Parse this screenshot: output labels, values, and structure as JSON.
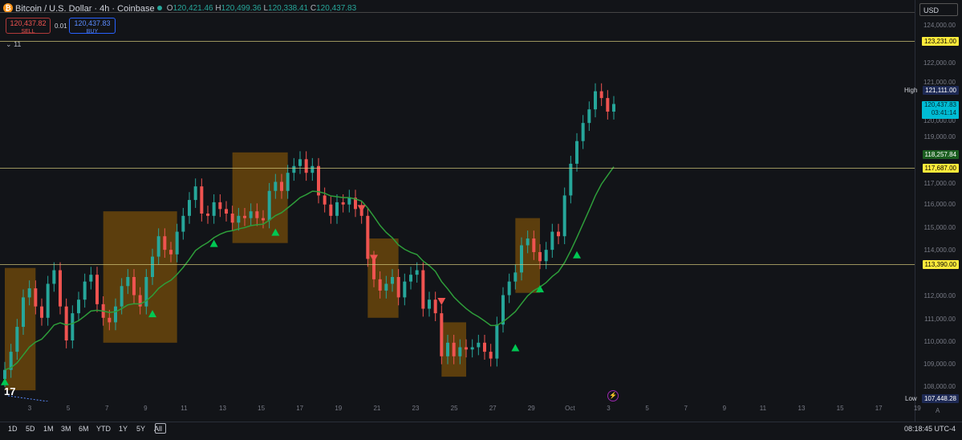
{
  "header": {
    "symbol_title": "Bitcoin / U.S. Dollar · 4h · Coinbase",
    "ohlc": [
      {
        "key": "O",
        "value": "120,421.46"
      },
      {
        "key": "H",
        "value": "120,499.36"
      },
      {
        "key": "L",
        "value": "120,338.41"
      },
      {
        "key": "C",
        "value": "120,437.83"
      }
    ]
  },
  "trade": {
    "sell_price": "120,437.82",
    "sell_label": "SELL",
    "spread": "0.01",
    "buy_price": "120,437.83",
    "buy_label": "BUY"
  },
  "indicators_toggle": "11",
  "currency": "USD",
  "price_axis": {
    "ticks": [
      "124,000.00",
      "122,000.00",
      "121,000.00",
      "120,000.00",
      "119,000.00",
      "117,000.00",
      "116,000.00",
      "115,000.00",
      "114,000.00",
      "112,000.00",
      "111,000.00",
      "110,000.00",
      "109,000.00",
      "108,000.00"
    ],
    "tags": {
      "level_1": "123,231.00",
      "high_label": "High",
      "high": "121,111.00",
      "last_price": "120,437.83",
      "countdown": "03:41:14",
      "ema": "118,257.84",
      "level_2": "117,687.00",
      "level_3": "113,390.00",
      "low_label": "Low",
      "low": "107,448.28"
    }
  },
  "time_axis": [
    "3",
    "5",
    "7",
    "9",
    "11",
    "13",
    "15",
    "17",
    "19",
    "21",
    "23",
    "25",
    "27",
    "29",
    "Oct",
    "3",
    "5",
    "7",
    "9",
    "11",
    "13",
    "15",
    "17",
    "19"
  ],
  "timeframes": [
    "1D",
    "5D",
    "1M",
    "3M",
    "6M",
    "YTD",
    "1Y",
    "5Y",
    "All"
  ],
  "clock": "08:18:45 UTC-4",
  "colors": {
    "up": "#26a69a",
    "down": "#ef5350",
    "accent_up": "#00c853",
    "band": "#b87000",
    "level": "#ffeb3b"
  },
  "chart_data": {
    "type": "candlestick",
    "timeframe": "4h",
    "y_range": [
      107448.28,
      124000
    ],
    "candles_close_approx": [
      108700,
      109500,
      110600,
      111900,
      112300,
      111500,
      111000,
      112500,
      113100,
      111500,
      110000,
      111200,
      111800,
      112600,
      112900,
      111600,
      111000,
      110800,
      111500,
      112400,
      112800,
      112000,
      111500,
      112800,
      113700,
      114600,
      114000,
      113800,
      114800,
      115500,
      116200,
      116800,
      115600,
      115500,
      116100,
      115800,
      115600,
      115200,
      115500,
      115400,
      115700,
      115400,
      115300,
      116600,
      117000,
      116600,
      117400,
      117700,
      118000,
      117400,
      117700,
      116400,
      116000,
      115500,
      116100,
      116000,
      116300,
      115800,
      115500,
      113600,
      112700,
      112200,
      112500,
      112800,
      111900,
      112600,
      112900,
      113100,
      111400,
      111800,
      111200,
      109300,
      109900,
      109300,
      109700,
      109600,
      109700,
      109900,
      109500,
      109200,
      110700,
      112000,
      112600,
      113000,
      114200,
      114500,
      113900,
      113500,
      114000,
      114800,
      114600,
      116400,
      117800,
      118800,
      119600,
      120200,
      121000,
      120700,
      120100,
      120437.83
    ],
    "last": 120437.83,
    "high": 121111.0,
    "low": 107448.28,
    "levels": [
      123231.0,
      117687.0,
      113390.0
    ],
    "ema_last": 118257.84
  }
}
